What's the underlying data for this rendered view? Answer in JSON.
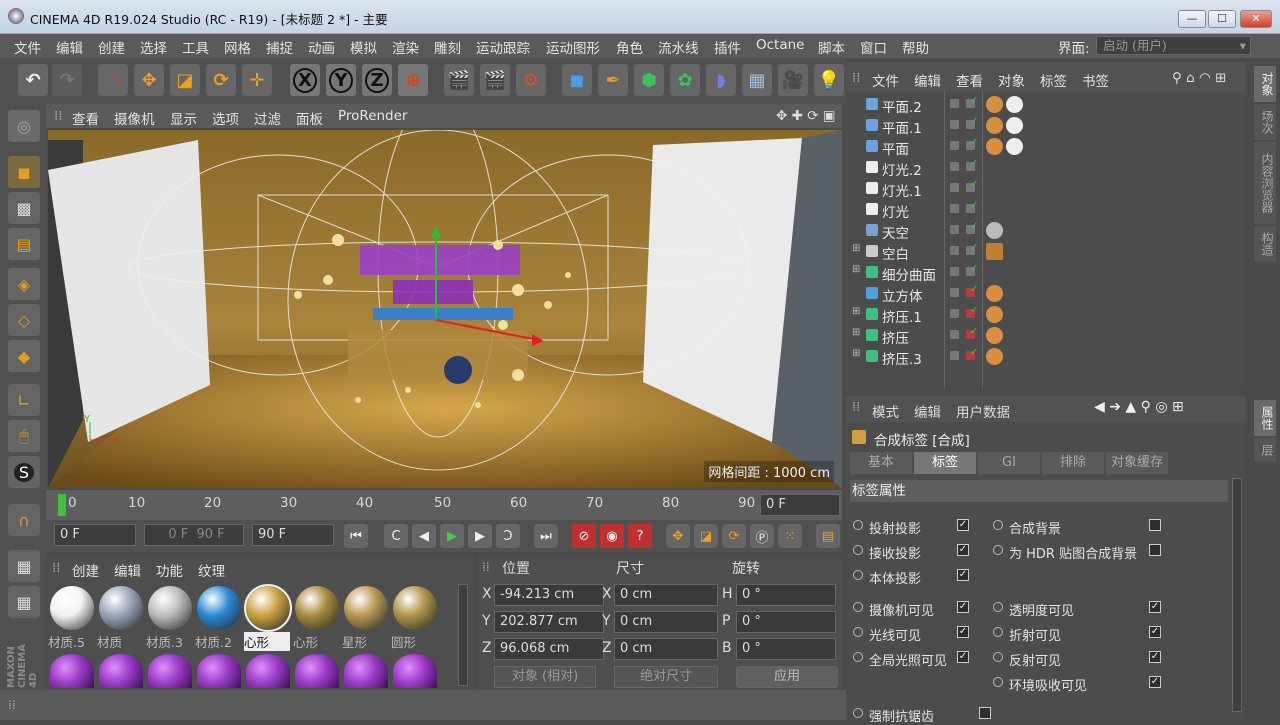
{
  "window": {
    "title": "CINEMA 4D R19.024 Studio (RC - R19) - [未标题 2 *] - 主要",
    "min": "—",
    "max": "☐",
    "close": "✕"
  },
  "menu": [
    "文件",
    "编辑",
    "创建",
    "选择",
    "工具",
    "网格",
    "捕捉",
    "动画",
    "模拟",
    "渲染",
    "雕刻",
    "运动跟踪",
    "运动图形",
    "角色",
    "流水线",
    "插件",
    "Octane",
    "脚本",
    "窗口",
    "帮助"
  ],
  "layout": {
    "label": "界面:",
    "value": "启动 (用户)"
  },
  "toolbar": {
    "undo": "↶",
    "redo": "↷",
    "x": "X",
    "y": "Y",
    "z": "Z"
  },
  "viewport": {
    "menu": [
      "查看",
      "摄像机",
      "显示",
      "选项",
      "过滤",
      "面板",
      "ProRender"
    ],
    "grid_label": "网格间距 : 1000 cm"
  },
  "timeline": {
    "ticks": [
      "0",
      "10",
      "20",
      "30",
      "40",
      "50",
      "60",
      "70",
      "80",
      "90"
    ],
    "current": "0 F"
  },
  "transport": {
    "start": "0 F",
    "range_start": "0 F",
    "range_end": "90 F",
    "end": "90 F"
  },
  "materials": {
    "menu": [
      "创建",
      "编辑",
      "功能",
      "纹理"
    ],
    "row1": [
      {
        "name": "材质.5",
        "color": "#f2f2f2"
      },
      {
        "name": "材质",
        "color": "#9aa6b8"
      },
      {
        "name": "材质.3",
        "color": "#bcbcbc"
      },
      {
        "name": "材质.2",
        "color": "#2a8ad6"
      },
      {
        "name": "心形",
        "color": "#c9a240"
      },
      {
        "name": "心形",
        "color": "#a88a3a"
      },
      {
        "name": "星形",
        "color": "#b89850"
      },
      {
        "name": "圆形",
        "color": "#b09448"
      }
    ],
    "row2_color": "#9c3cc8"
  },
  "coords": {
    "headers": [
      "位置",
      "尺寸",
      "旋转"
    ],
    "pos": {
      "x": "-94.213 cm",
      "y": "202.877 cm",
      "z": "96.068 cm"
    },
    "size": {
      "x": "0 cm",
      "y": "0 cm",
      "z": "0 cm"
    },
    "rot": {
      "h": "0 °",
      "p": "0 °",
      "b": "0 °"
    },
    "labels": {
      "x": "X",
      "y": "Y",
      "z": "Z",
      "h": "H",
      "p": "P",
      "b": "B"
    },
    "mode": "对象 (相对)",
    "size_mode": "绝对尺寸",
    "apply": "应用"
  },
  "objects": {
    "menu": [
      "文件",
      "编辑",
      "查看",
      "对象",
      "标签",
      "书签"
    ],
    "items": [
      {
        "name": "平面.2",
        "icon": "#6aa4e0",
        "tags": 2
      },
      {
        "name": "平面.1",
        "icon": "#6aa4e0",
        "tags": 2
      },
      {
        "name": "平面",
        "icon": "#6aa4e0",
        "tags": 2
      },
      {
        "name": "灯光.2",
        "icon": "#eeeeee",
        "tags": 0
      },
      {
        "name": "灯光.1",
        "icon": "#eeeeee",
        "tags": 0
      },
      {
        "name": "灯光",
        "icon": "#eeeeee",
        "tags": 0
      },
      {
        "name": "天空",
        "icon": "#7aa0d0",
        "tags": 1
      },
      {
        "name": "空白",
        "icon": "#cccccc",
        "tags": 1
      },
      {
        "name": "细分曲面",
        "icon": "#40c080",
        "tags": 0
      },
      {
        "name": "立方体",
        "icon": "#50a0e0",
        "tags": 1
      },
      {
        "name": "挤压.1",
        "icon": "#40c080",
        "tags": 1
      },
      {
        "name": "挤压",
        "icon": "#40c080",
        "tags": 1
      },
      {
        "name": "挤压.3",
        "icon": "#40c080",
        "tags": 1
      }
    ]
  },
  "attributes": {
    "menu": [
      "模式",
      "编辑",
      "用户数据"
    ],
    "title": "合成标签 [合成]",
    "tabs": [
      "基本",
      "标签",
      "GI",
      "排除",
      "对象缓存"
    ],
    "section": "标签属性",
    "props_left": [
      "投射投影",
      "接收投影",
      "本体投影",
      "摄像机可见",
      "光线可见",
      "全局光照可见",
      "强制抗锯齿"
    ],
    "props_right": [
      "合成背景",
      "为 HDR 贴图合成背景",
      "透明度可见",
      "折射可见",
      "反射可见",
      "环境吸收可见"
    ]
  },
  "right_tabs": [
    "对象",
    "场次",
    "内容浏览器",
    "构造"
  ],
  "right_tabs2": [
    "属性",
    "层"
  ]
}
